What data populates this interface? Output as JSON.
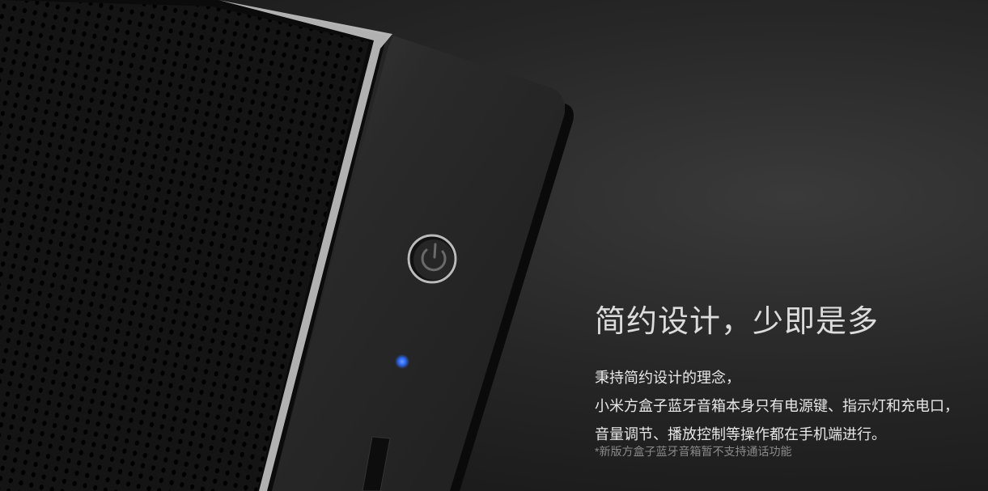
{
  "product_image": {
    "icon": "power-icon",
    "indicator_color": "#2d6bff"
  },
  "feature": {
    "title": "简约设计，少即是多",
    "lines": [
      "秉持简约设计的理念，",
      "小米方盒子蓝牙音箱本身只有电源键、指示灯和充电口，",
      "音量调节、播放控制等操作都在手机端进行。"
    ],
    "note": "*新版方盒子蓝牙音箱暂不支持通话功能"
  }
}
